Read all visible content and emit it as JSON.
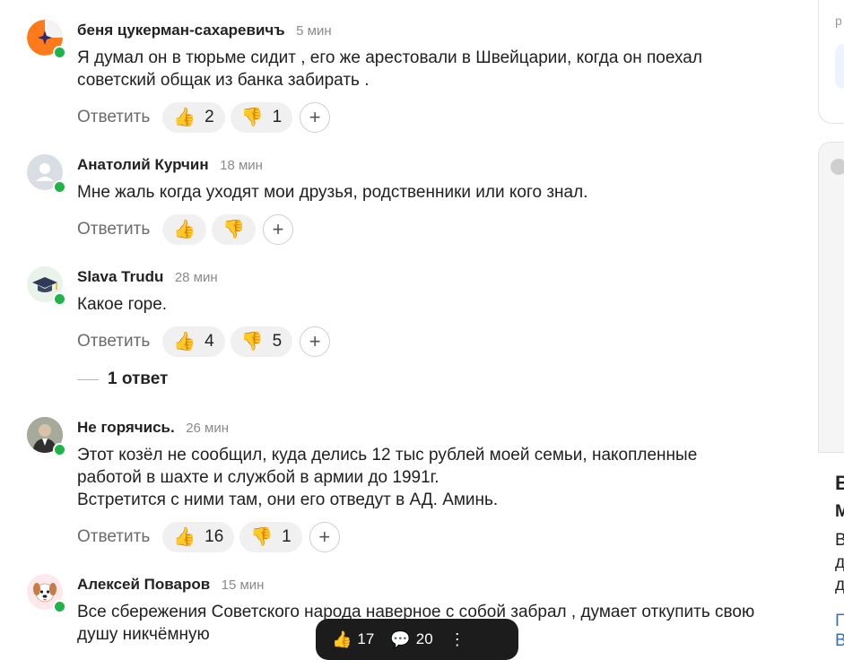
{
  "reply_label": "Ответить",
  "comments": [
    {
      "author": "беня цукерман-сахаревичъ",
      "time": "5 мин",
      "text": "Я думал он в тюрьме сидит , его же арестовали в Швейцарии, когда он поехал советский общак из банка забирать .",
      "likes": "2",
      "dislikes": "1"
    },
    {
      "author": "Анатолий Курчин",
      "time": "18 мин",
      "text": "Мне жаль когда уходят мои друзья, родственники или кого знал.",
      "likes": "",
      "dislikes": ""
    },
    {
      "author": "Slava Trudu",
      "time": "28 мин",
      "text": "Какое горе.",
      "likes": "4",
      "dislikes": "5",
      "replies": "1 ответ"
    },
    {
      "author": "Не горячись.",
      "time": "26 мин",
      "text_lines": [
        "Этот козёл не сообщил, куда делись 12 тыс рублей моей семьи, накопленные",
        "работой в шахте и службой в армии до 1991г.",
        "Встретится с ними там, они его отведут в АД. Аминь."
      ],
      "likes": "16",
      "dislikes": "1"
    },
    {
      "author": "Алексей Поваров",
      "time": "15 мин",
      "text": "Все сбережения Советского народа наверное с собой забрал , думает откупить свою душу никчёмную"
    }
  ],
  "right_panel": {
    "card_text": "р",
    "letter_big": "В",
    "letter_med": "М",
    "letters": [
      "В",
      "д",
      "д"
    ],
    "link_letters": [
      "Г",
      "В"
    ]
  },
  "bottom_bar": {
    "likes": "17",
    "comments": "20"
  },
  "icons": {
    "like": "thumbs-up-icon",
    "dislike": "thumbs-down-icon",
    "add_reaction": "plus-icon"
  }
}
